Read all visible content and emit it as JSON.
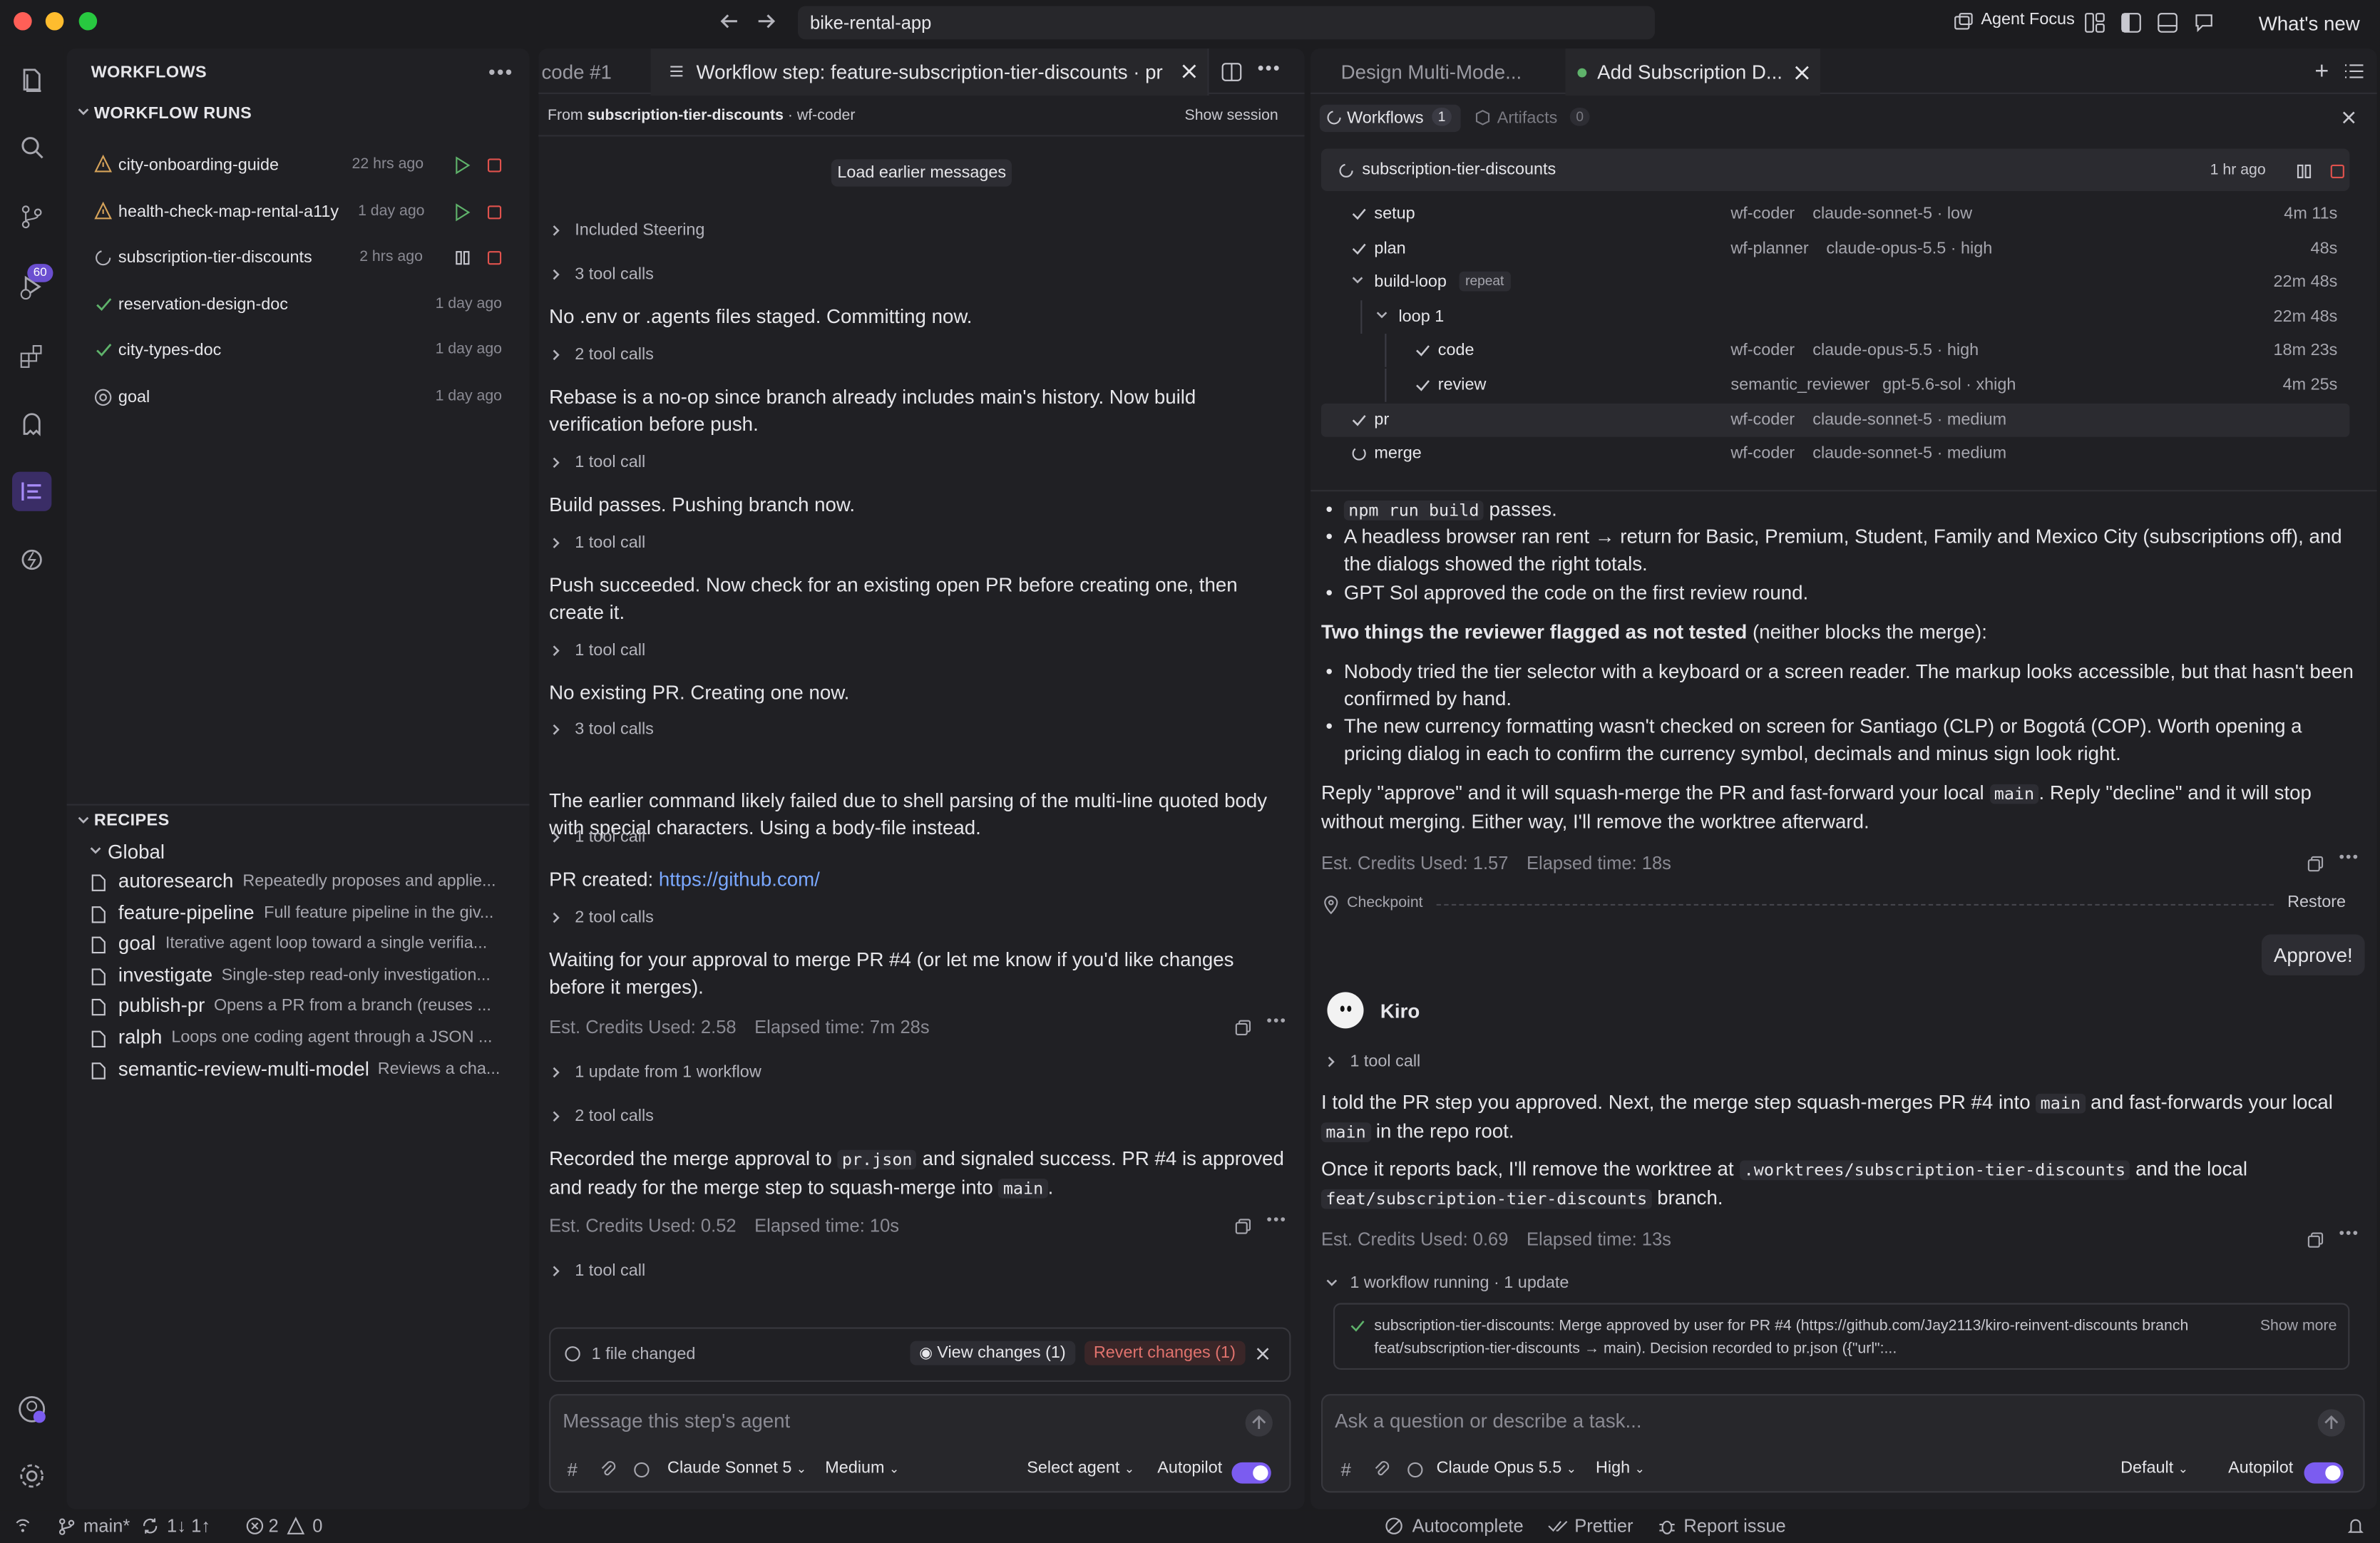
{
  "titlebar": {
    "address": "bike-rental-app",
    "agent_focus": "Agent Focus",
    "whats_new": "What's new"
  },
  "activity": {
    "badge": "60"
  },
  "sidebar": {
    "title": "WORKFLOWS",
    "runs_header": "WORKFLOW RUNS",
    "runs": [
      {
        "name": "city-onboarding-guide",
        "time": "22 hrs ago"
      },
      {
        "name": "health-check-map-rental-a11y",
        "time": "1 day ago"
      },
      {
        "name": "subscription-tier-discounts",
        "time": "2 hrs ago"
      },
      {
        "name": "reservation-design-doc",
        "time": "1 day ago"
      },
      {
        "name": "city-types-doc",
        "time": "1 day ago"
      },
      {
        "name": "goal",
        "time": "1 day ago"
      }
    ],
    "recipes_header": "RECIPES",
    "global_label": "Global",
    "recipes": [
      {
        "name": "autoresearch",
        "desc": "Repeatedly proposes and applie..."
      },
      {
        "name": "feature-pipeline",
        "desc": "Full feature pipeline in the giv..."
      },
      {
        "name": "goal",
        "desc": "Iterative agent loop toward a single verifia..."
      },
      {
        "name": "investigate",
        "desc": "Single-step read-only investigation..."
      },
      {
        "name": "publish-pr",
        "desc": "Opens a PR from a branch (reuses ..."
      },
      {
        "name": "ralph",
        "desc": "Loops one coding agent through a JSON ..."
      },
      {
        "name": "semantic-review-multi-model",
        "desc": "Reviews a cha..."
      }
    ]
  },
  "mid": {
    "tab_prev": "code #1",
    "tab_active": "Workflow step: feature-subscription-tier-discounts · pr",
    "from_prefix": "From",
    "from_name": "subscription-tier-discounts",
    "from_agent": "· wf-coder",
    "show_session": "Show session",
    "load_earlier": "Load earlier messages",
    "steering": "Included Steering",
    "tc1": "3 tool calls",
    "m1": "No .env or .agents files staged. Committing now.",
    "tc2": "2 tool calls",
    "m2": "Rebase is a no-op since branch already includes main's history. Now build verification before push.",
    "tc3": "1 tool call",
    "m3": "Build passes. Pushing branch now.",
    "tc4": "1 tool call",
    "m4": "Push succeeded. Now check for an existing open PR before creating one, then create it.",
    "tc5": "1 tool call",
    "m5": "No existing PR. Creating one now.",
    "tc6": "3 tool calls",
    "m6": "The earlier command likely failed due to shell parsing of the multi-line quoted body with special characters. Using a body-file instead.",
    "tc7": "1 tool call",
    "m7_prefix": "PR created:",
    "m7_link": "https://github.com/",
    "tc8": "2 tool calls",
    "m8": "Waiting for your approval to merge PR #4 (or let me know if you'd like changes before it merges).",
    "stats1_credits": "Est. Credits Used: 2.58",
    "stats1_time": "Elapsed time: 7m 28s",
    "upd": "1 update from 1 workflow",
    "tc9": "2 tool calls",
    "m9_a": "Recorded the merge approval to",
    "m9_code1": "pr.json",
    "m9_b": "and signaled success. PR #4 is approved",
    "m9_c": "and ready for the merge step to squash-merge into",
    "m9_code2": "main",
    "m9_d": ".",
    "stats2_credits": "Est. Credits Used: 0.52",
    "stats2_time": "Elapsed time: 10s",
    "tc10": "1 tool call",
    "files_changed": "1 file changed",
    "view_changes": "View changes (1)",
    "revert_changes": "Revert changes (1)",
    "composer_placeholder": "Message this step's agent",
    "model": "Claude Sonnet 5",
    "effort": "Medium",
    "select_agent": "Select agent",
    "autopilot": "Autopilot"
  },
  "right": {
    "tab_prev": "Design Multi-Mode...",
    "tab_active": "Add Subscription D...",
    "workflows_tab": "Workflows",
    "workflows_count": "1",
    "artifacts_tab": "Artifacts",
    "artifacts_count": "0",
    "wf_name": "subscription-tier-discounts",
    "wf_time": "1 hr ago",
    "steps": [
      {
        "name": "setup",
        "agent": "wf-coder",
        "model": "claude-sonnet-5 · low",
        "time": "4m 11s"
      },
      {
        "name": "plan",
        "agent": "wf-planner",
        "model": "claude-opus-5.5 · high",
        "time": "48s"
      },
      {
        "name": "build-loop",
        "tag": "repeat",
        "agent": "",
        "model": "",
        "time": "22m 48s"
      },
      {
        "name": "loop 1",
        "agent": "",
        "model": "",
        "time": "22m 48s"
      },
      {
        "name": "code",
        "agent": "wf-coder",
        "model": "claude-opus-5.5 · high",
        "time": "18m 23s"
      },
      {
        "name": "review",
        "agent": "semantic_reviewer",
        "model": "gpt-5.6-sol · xhigh",
        "time": "4m 25s"
      },
      {
        "name": "pr",
        "agent": "wf-coder",
        "model": "claude-sonnet-5 · medium",
        "time": ""
      },
      {
        "name": "merge",
        "agent": "wf-coder",
        "model": "claude-sonnet-5 · medium",
        "time": ""
      }
    ],
    "b1_code": "npm run build",
    "b1_rest": "passes.",
    "b2": "A headless browser ran rent → return for Basic, Premium, Student, Family and Mexico City (subscriptions off), and the dialogs showed the right totals.",
    "b3": "GPT Sol approved the code on the first review round.",
    "flag_bold": "Two things the reviewer flagged as not tested",
    "flag_rest": "(neither blocks the merge):",
    "f1": "Nobody tried the tier selector with a keyboard or a screen reader. The markup looks accessible, but that hasn't been confirmed by hand.",
    "f2": "The new currency formatting wasn't checked on screen for Santiago (CLP) or Bogotá (COP). Worth opening a pricing dialog in each to confirm the currency symbol, decimals and minus sign look right.",
    "reply_a": "Reply \"approve\" and it will squash-merge the PR and fast-forward your local",
    "reply_code": "main",
    "reply_b": ". Reply \"decline\" and it will stop without merging. Either way, I'll remove the worktree afterward.",
    "stats1_credits": "Est. Credits Used: 1.57",
    "stats1_time": "Elapsed time: 18s",
    "checkpoint": "Checkpoint",
    "restore": "Restore",
    "user_msg": "Approve!",
    "agent_name": "Kiro",
    "tc": "1 tool call",
    "k1_a": "I told the PR step you approved. Next, the merge step squash-merges PR #4 into",
    "k1_code": "main",
    "k1_b": "and fast-forwards your local",
    "k1_code2": "main",
    "k1_c": "in the repo root.",
    "k2_a": "Once it reports back, I'll remove the worktree at",
    "k2_code": ".worktrees/subscription-tier-discounts",
    "k2_b": "and the local",
    "k2_code2": "feat/subscription-tier-discounts",
    "k2_c": "branch.",
    "stats2_credits": "Est. Credits Used: 0.69",
    "stats2_time": "Elapsed time: 13s",
    "running": "1 workflow running · 1 update",
    "update_text": "subscription-tier-discounts: Merge approved by user for PR #4 (https://github.com/Jay2113/kiro-reinvent-discounts branch feat/subscription-tier-discounts → main). Decision recorded to pr.json ({\"url\":...",
    "show_more": "Show more",
    "composer_placeholder": "Ask a question or describe a task...",
    "model": "Claude Opus 5.5",
    "effort": "High",
    "mode": "Default",
    "autopilot": "Autopilot"
  },
  "status": {
    "branch": "main*",
    "sync": "1↓ 1↑",
    "errors": "2",
    "warnings": "0",
    "autocomplete": "Autocomplete",
    "prettier": "Prettier",
    "report": "Report issue"
  },
  "colors": {
    "accent": "#7b5cf0",
    "green": "#5fb36b",
    "red": "#e0524d",
    "yellow": "#e0b44d"
  }
}
